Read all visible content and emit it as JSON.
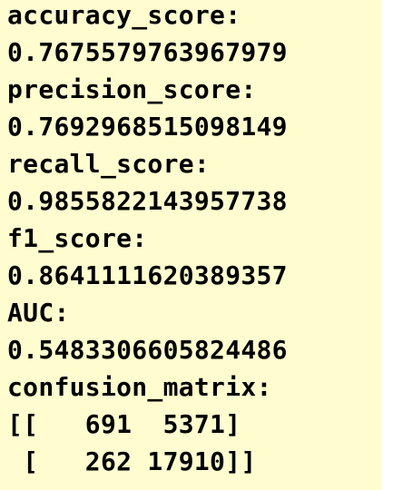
{
  "output_lines": [
    "accuracy_score:",
    "0.7675579763967979",
    "precision_score:",
    "0.7692968515098149",
    "recall_score:",
    "0.9855822143957738",
    "f1_score:",
    "0.8641111620389357",
    "AUC:",
    "0.5483306605824486",
    "confusion_matrix:",
    "[[   691  5371]",
    " [   262 17910]]"
  ],
  "colors": {
    "background": "#fffdd0",
    "text": "#000000"
  }
}
